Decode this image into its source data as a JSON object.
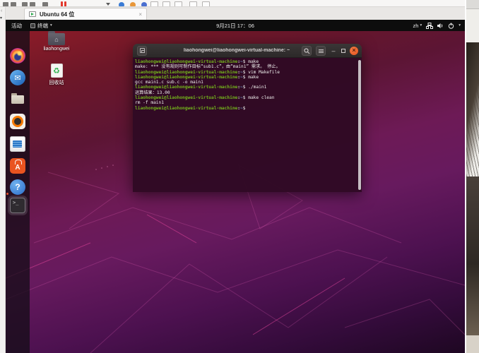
{
  "vmware": {
    "tab_title": "Ubuntu 64 位",
    "tab_close": "×",
    "side_scroll_left": "‹",
    "side_scroll_down": "▾"
  },
  "ubuntu_topbar": {
    "activities": "活动",
    "app_menu": "终端",
    "app_menu_caret": "▾",
    "clock": "9月21日 17：06",
    "input_lang": "zh",
    "lang_caret": "▾",
    "system_caret": "▾"
  },
  "dock": {
    "items": [
      "firefox",
      "thunderbird",
      "files",
      "rhythmbox",
      "writer",
      "software",
      "help",
      "terminal"
    ]
  },
  "desktop": {
    "icons": [
      {
        "label": "liaohongwei"
      },
      {
        "label": "回收站"
      }
    ]
  },
  "terminal": {
    "title": "liaohongwei@liaohongwei-virtual-machine: ~",
    "prompt_user_host": "liaohongwei@liaohongwei-virtual-machine",
    "prompt_separator": ":",
    "prompt_path": "~",
    "prompt_symbol": "$",
    "lines": [
      {
        "prompt": true,
        "cmd": "make"
      },
      {
        "prompt": false,
        "out": "make: *** 没有规则可制作目标“sub1.c”，由“main1” 需求。 停止。"
      },
      {
        "prompt": true,
        "cmd": "vim Makefile"
      },
      {
        "prompt": true,
        "cmd": "make"
      },
      {
        "prompt": false,
        "out": "gcc main1.c sub.c -o main1"
      },
      {
        "prompt": true,
        "cmd": "./main1"
      },
      {
        "prompt": false,
        "out": "运算结果：13.00"
      },
      {
        "prompt": true,
        "cmd": "make clean"
      },
      {
        "prompt": false,
        "out": "rm -f main1"
      },
      {
        "prompt": true,
        "cmd": ""
      }
    ]
  },
  "colors": {
    "prompt_green": "#73b41c",
    "path_blue": "#729fcf",
    "terminal_bg": "#300a24",
    "titlebar_bg": "#2c2929",
    "close_button": "#e9541f",
    "gnome_topbar_bg": "#0d0d0d",
    "ubuntu_orange": "#e95420"
  }
}
